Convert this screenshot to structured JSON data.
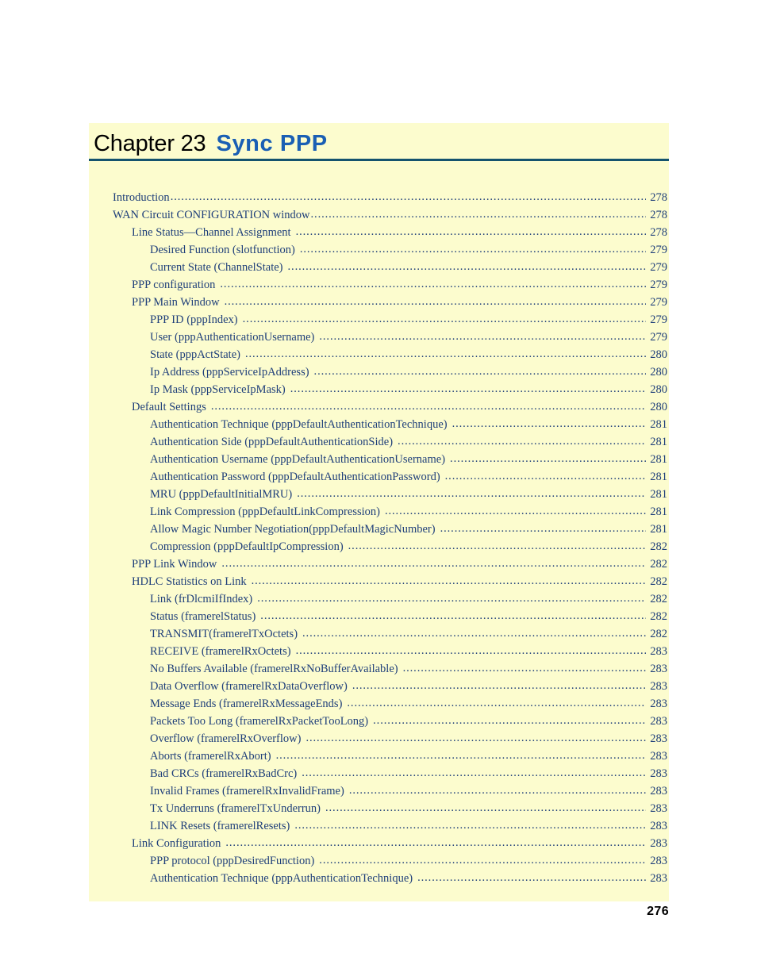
{
  "document": {
    "chapter_prefix": "Chapter 23",
    "chapter_title": "Sync PPP",
    "folio": "276",
    "colors": {
      "panel_background": "#fcfcce",
      "rule": "#14536e",
      "title_accent": "#1a5fb4",
      "toc_text": "#1f3f7a",
      "folio_text": "#000000",
      "page_background": "#ffffff"
    }
  },
  "toc": {
    "entries": [
      {
        "label": "Introduction",
        "page": "278",
        "level": 0,
        "gap": false
      },
      {
        "label": "WAN Circuit CONFIGURATION window",
        "page": "278",
        "level": 0,
        "gap": false
      },
      {
        "label": "Line Status—Channel Assignment",
        "page": "278",
        "level": 1,
        "gap": true
      },
      {
        "label": "Desired Function (slotfunction)",
        "page": "279",
        "level": 2,
        "gap": true
      },
      {
        "label": "Current State (ChannelState)",
        "page": "279",
        "level": 2,
        "gap": true
      },
      {
        "label": "PPP configuration",
        "page": "279",
        "level": 1,
        "gap": true
      },
      {
        "label": "PPP Main Window",
        "page": "279",
        "level": 1,
        "gap": true
      },
      {
        "label": "PPP ID (pppIndex)",
        "page": "279",
        "level": 2,
        "gap": true
      },
      {
        "label": "User (pppAuthenticationUsername)",
        "page": "279",
        "level": 2,
        "gap": true
      },
      {
        "label": "State (pppActState)",
        "page": "280",
        "level": 2,
        "gap": true
      },
      {
        "label": "Ip Address (pppServiceIpAddress)",
        "page": "280",
        "level": 2,
        "gap": true
      },
      {
        "label": "Ip Mask (pppServiceIpMask)",
        "page": "280",
        "level": 2,
        "gap": true
      },
      {
        "label": "Default Settings",
        "page": "280",
        "level": 1,
        "gap": true
      },
      {
        "label": "Authentication Technique (pppDefaultAuthenticationTechnique)",
        "page": "281",
        "level": 2,
        "gap": true
      },
      {
        "label": "Authentication Side (pppDefaultAuthenticationSide)",
        "page": "281",
        "level": 2,
        "gap": true
      },
      {
        "label": "Authentication Username (pppDefaultAuthenticationUsername)",
        "page": "281",
        "level": 2,
        "gap": true
      },
      {
        "label": "Authentication Password (pppDefaultAuthenticationPassword)",
        "page": "281",
        "level": 2,
        "gap": true
      },
      {
        "label": "MRU (pppDefaultInitialMRU)",
        "page": "281",
        "level": 2,
        "gap": true
      },
      {
        "label": "Link Compression (pppDefaultLinkCompression)",
        "page": "281",
        "level": 2,
        "gap": true
      },
      {
        "label": "Allow Magic Number Negotiation(pppDefaultMagicNumber)",
        "page": "281",
        "level": 2,
        "gap": true
      },
      {
        "label": "Compression (pppDefaultIpCompression)",
        "page": "282",
        "level": 2,
        "gap": true
      },
      {
        "label": "PPP Link Window",
        "page": "282",
        "level": 1,
        "gap": true
      },
      {
        "label": "HDLC Statistics on Link",
        "page": "282",
        "level": 1,
        "gap": true
      },
      {
        "label": "Link (frDlcmiIfIndex)",
        "page": "282",
        "level": 2,
        "gap": true
      },
      {
        "label": "Status (framerelStatus)",
        "page": "282",
        "level": 2,
        "gap": true
      },
      {
        "label": "TRANSMIT(framerelTxOctets)",
        "page": "282",
        "level": 2,
        "gap": true
      },
      {
        "label": "RECEIVE (framerelRxOctets)",
        "page": "283",
        "level": 2,
        "gap": true
      },
      {
        "label": "No Buffers Available (framerelRxNoBufferAvailable)",
        "page": "283",
        "level": 2,
        "gap": true
      },
      {
        "label": "Data Overflow (framerelRxDataOverflow)",
        "page": "283",
        "level": 2,
        "gap": true
      },
      {
        "label": "Message Ends (framerelRxMessageEnds)",
        "page": "283",
        "level": 2,
        "gap": true
      },
      {
        "label": "Packets Too Long (framerelRxPacketTooLong)",
        "page": "283",
        "level": 2,
        "gap": true
      },
      {
        "label": "Overflow (framerelRxOverflow)",
        "page": "283",
        "level": 2,
        "gap": true
      },
      {
        "label": "Aborts (framerelRxAbort)",
        "page": "283",
        "level": 2,
        "gap": true
      },
      {
        "label": "Bad CRCs (framerelRxBadCrc)",
        "page": "283",
        "level": 2,
        "gap": true
      },
      {
        "label": "Invalid Frames (framerelRxInvalidFrame)",
        "page": "283",
        "level": 2,
        "gap": true
      },
      {
        "label": "Tx Underruns (framerelTxUnderrun)",
        "page": "283",
        "level": 2,
        "gap": true
      },
      {
        "label": "LINK Resets (framerelResets)",
        "page": "283",
        "level": 2,
        "gap": true
      },
      {
        "label": "Link Configuration",
        "page": "283",
        "level": 1,
        "gap": true
      },
      {
        "label": "PPP protocol (pppDesiredFunction)",
        "page": "283",
        "level": 2,
        "gap": true
      },
      {
        "label": "Authentication Technique (pppAuthenticationTechnique)",
        "page": "283",
        "level": 2,
        "gap": true
      }
    ]
  }
}
